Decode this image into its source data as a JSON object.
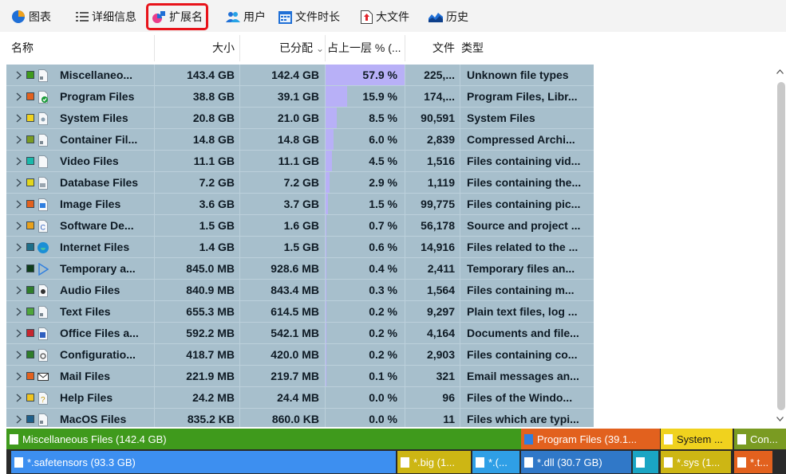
{
  "toolbar": {
    "tabs": [
      {
        "label": "图表",
        "icon": "pie-chart-icon"
      },
      {
        "label": "详细信息",
        "icon": "details-list-icon"
      },
      {
        "label": "扩展名",
        "icon": "extension-icon",
        "active": true
      },
      {
        "label": "用户",
        "icon": "users-icon"
      },
      {
        "label": "文件时长",
        "icon": "calendar-icon"
      },
      {
        "label": "大文件",
        "icon": "large-file-icon"
      },
      {
        "label": "历史",
        "icon": "history-chart-icon"
      }
    ],
    "highlight_color": "#e8131a"
  },
  "table": {
    "columns": {
      "name": "名称",
      "size": "大小",
      "allocated": "已分配",
      "percent": "占上一层 % (...",
      "files": "文件",
      "type": "类型"
    },
    "sort_indicator": "⌄",
    "rows": [
      {
        "name": "Miscellaneo...",
        "size": "143.4 GB",
        "allocated": "142.4 GB",
        "percent": "57.9 %",
        "percent_value": 57.9,
        "files": "225,...",
        "type": "Unknown file types",
        "color": "#3f9a1c",
        "icon": "generic-file-icon"
      },
      {
        "name": "Program Files",
        "size": "38.8 GB",
        "allocated": "39.1 GB",
        "percent": "15.9 %",
        "percent_value": 15.9,
        "files": "174,...",
        "type": "Program Files, Libr...",
        "color": "#e2611e",
        "icon": "program-files-icon"
      },
      {
        "name": "System Files",
        "size": "20.8 GB",
        "allocated": "21.0 GB",
        "percent": "8.5 %",
        "percent_value": 8.5,
        "files": "90,591",
        "type": "System Files",
        "color": "#f0d21e",
        "icon": "system-file-icon"
      },
      {
        "name": "Container Fil...",
        "size": "14.8 GB",
        "allocated": "14.8 GB",
        "percent": "6.0 %",
        "percent_value": 6.0,
        "files": "2,839",
        "type": "Compressed Archi...",
        "color": "#7a9b22",
        "icon": "archive-file-icon"
      },
      {
        "name": "Video Files",
        "size": "11.1 GB",
        "allocated": "11.1 GB",
        "percent": "4.5 %",
        "percent_value": 4.5,
        "files": "1,516",
        "type": "Files containing vid...",
        "color": "#19b9aa",
        "icon": "blank-file-icon"
      },
      {
        "name": "Database Files",
        "size": "7.2 GB",
        "allocated": "7.2 GB",
        "percent": "2.9 %",
        "percent_value": 2.9,
        "files": "1,119",
        "type": "Files containing the...",
        "color": "#e3d61b",
        "icon": "database-file-icon"
      },
      {
        "name": "Image Files",
        "size": "3.6 GB",
        "allocated": "3.7 GB",
        "percent": "1.5 %",
        "percent_value": 1.5,
        "files": "99,775",
        "type": "Files containing pic...",
        "color": "#e2611e",
        "icon": "image-file-icon"
      },
      {
        "name": "Software De...",
        "size": "1.5 GB",
        "allocated": "1.6 GB",
        "percent": "0.7 %",
        "percent_value": 0.7,
        "files": "56,178",
        "type": "Source and project ...",
        "color": "#e8a11c",
        "icon": "source-code-icon"
      },
      {
        "name": "Internet Files",
        "size": "1.4 GB",
        "allocated": "1.5 GB",
        "percent": "0.6 %",
        "percent_value": 0.6,
        "files": "14,916",
        "type": "Files related to the ...",
        "color": "#1e6f8a",
        "icon": "edge-browser-icon"
      },
      {
        "name": "Temporary a...",
        "size": "845.0 MB",
        "allocated": "928.6 MB",
        "percent": "0.4 %",
        "percent_value": 0.4,
        "files": "2,411",
        "type": "Temporary files an...",
        "color": "#0f3d1a",
        "icon": "play-icon"
      },
      {
        "name": "Audio Files",
        "size": "840.9 MB",
        "allocated": "843.4 MB",
        "percent": "0.3 %",
        "percent_value": 0.3,
        "files": "1,564",
        "type": "Files containing m...",
        "color": "#2f7d2a",
        "icon": "audio-file-icon"
      },
      {
        "name": "Text Files",
        "size": "655.3 MB",
        "allocated": "614.5 MB",
        "percent": "0.2 %",
        "percent_value": 0.2,
        "files": "9,297",
        "type": "Plain text files, log ...",
        "color": "#4ea63a",
        "icon": "text-file-icon"
      },
      {
        "name": "Office Files a...",
        "size": "592.2 MB",
        "allocated": "542.1 MB",
        "percent": "0.2 %",
        "percent_value": 0.2,
        "files": "4,164",
        "type": "Documents and file...",
        "color": "#c6262e",
        "icon": "word-doc-icon"
      },
      {
        "name": "Configuratio...",
        "size": "418.7 MB",
        "allocated": "420.0 MB",
        "percent": "0.2 %",
        "percent_value": 0.2,
        "files": "2,903",
        "type": "Files containing co...",
        "color": "#2f7d2a",
        "icon": "config-file-icon"
      },
      {
        "name": "Mail Files",
        "size": "221.9 MB",
        "allocated": "219.7 MB",
        "percent": "0.1 %",
        "percent_value": 0.1,
        "files": "321",
        "type": "Email messages an...",
        "color": "#e2611e",
        "icon": "mail-icon"
      },
      {
        "name": "Help Files",
        "size": "24.2 MB",
        "allocated": "24.4 MB",
        "percent": "0.0 %",
        "percent_value": 0.0,
        "files": "96",
        "type": "Files of the Windo...",
        "color": "#f0c41e",
        "icon": "help-file-icon"
      },
      {
        "name": "MacOS Files",
        "size": "835.2 KB",
        "allocated": "860.0 KB",
        "percent": "0.0 %",
        "percent_value": 0.0,
        "files": "11",
        "type": "Files which are typi...",
        "color": "#1e5f8a",
        "icon": "generic-file-icon"
      }
    ]
  },
  "treemap": {
    "blocks": [
      {
        "label": "Miscellaneous Files (142.4 GB)",
        "color": "#3f9a1c"
      },
      {
        "label": "*.safetensors (93.3 GB)",
        "color": "#3d8ff0"
      },
      {
        "label": "*.big (1...",
        "color": "#cdb614"
      },
      {
        "label": "*.(...",
        "color": "#2f9fe6"
      },
      {
        "label": "Program Files (39.1...",
        "color": "#e2611e"
      },
      {
        "label": "*.dll (30.7 GB)",
        "color": "#3078c8"
      },
      {
        "label": "System ...",
        "color": "#f0d21e"
      },
      {
        "label": "*.sys (1...",
        "color": "#cdb614"
      },
      {
        "label": "Con...",
        "color": "#7a9b22"
      },
      {
        "label": "*.t...",
        "color": "#e2611e"
      }
    ]
  }
}
